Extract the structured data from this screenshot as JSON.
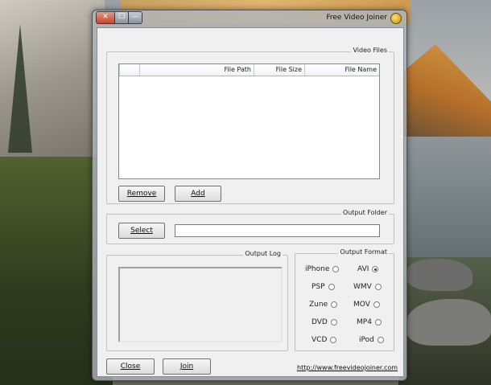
{
  "window": {
    "title": "Free Video Joiner",
    "controls": {
      "close": "✕",
      "maximize": "☐",
      "minimize": "—"
    }
  },
  "video_files": {
    "legend": "Video Files",
    "columns": [
      "File Name",
      "File Size",
      "File Path"
    ],
    "rows": [],
    "add_label": "Add",
    "remove_label": "Remove"
  },
  "output_folder": {
    "legend": "Output Folder",
    "value": "",
    "select_label": "Select"
  },
  "output_format": {
    "legend": "Output Format",
    "options": [
      {
        "label": "AVI",
        "selected": true
      },
      {
        "label": "iPhone",
        "selected": false
      },
      {
        "label": "WMV",
        "selected": false
      },
      {
        "label": "PSP",
        "selected": false
      },
      {
        "label": "MOV",
        "selected": false
      },
      {
        "label": "Zune",
        "selected": false
      },
      {
        "label": "MP4",
        "selected": false
      },
      {
        "label": "DVD",
        "selected": false
      },
      {
        "label": "iPod",
        "selected": false
      },
      {
        "label": "VCD",
        "selected": false
      }
    ]
  },
  "output_log": {
    "legend": "Output Log",
    "text": ""
  },
  "footer": {
    "url": "http://www.freevideojoiner.com",
    "join_label": "Join",
    "close_label": "Close"
  }
}
